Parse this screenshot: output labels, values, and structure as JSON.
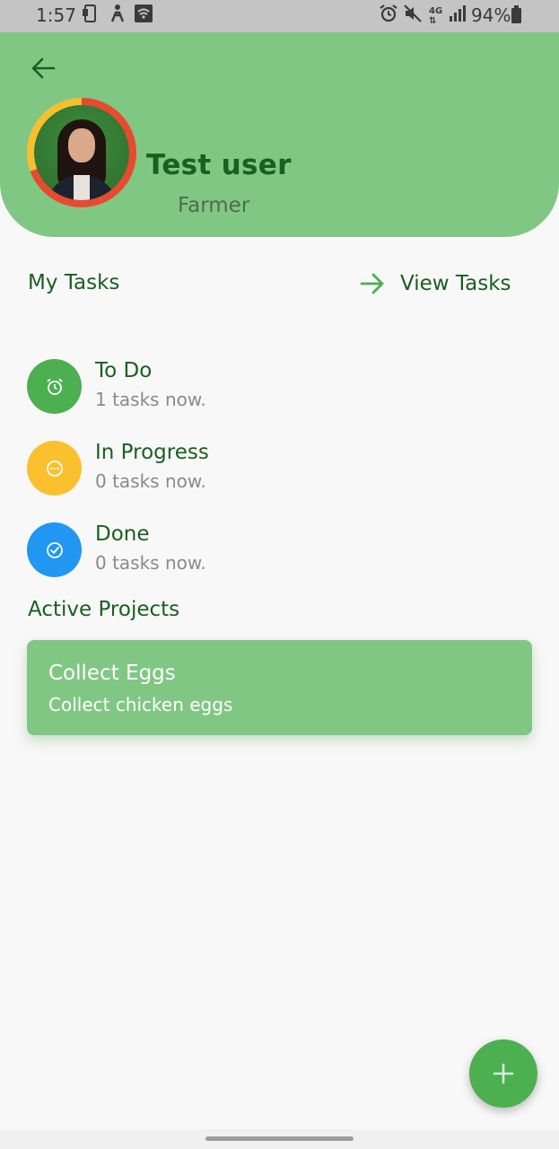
{
  "status_bar": {
    "time": "1:57",
    "battery_percent": "94%",
    "left_icons": [
      "screenshot-icon",
      "accessibility-icon",
      "wifi-icon"
    ],
    "right_icons": [
      "alarm-icon",
      "mute-icon",
      "4g-icon",
      "signal-icon",
      "battery-icon"
    ]
  },
  "header": {
    "user_name": "Test user",
    "user_role": "Farmer",
    "avatar_ring_colors": [
      "#e84a2f",
      "#f5c030"
    ],
    "background": "#81c784"
  },
  "tasks_section": {
    "title": "My Tasks",
    "view_label": "View Tasks",
    "items": [
      {
        "title": "To Do",
        "subtitle": "1 tasks now.",
        "icon": "alarm-clock-icon",
        "color": "#4caf50"
      },
      {
        "title": "In Progress",
        "subtitle": "0 tasks now.",
        "icon": "loading-icon",
        "color": "#fbc02d"
      },
      {
        "title": "Done",
        "subtitle": "0 tasks now.",
        "icon": "check-circle-icon",
        "color": "#2196f3"
      }
    ]
  },
  "projects_section": {
    "title": "Active Projects",
    "items": [
      {
        "title": "Collect Eggs",
        "description": "Collect chicken eggs"
      }
    ]
  },
  "fab": {
    "icon": "plus-icon",
    "color": "#4caf50"
  },
  "colors": {
    "primary_dark": "#1b5e20",
    "primary": "#4caf50",
    "primary_light": "#81c784",
    "muted_text": "#8a8a8a"
  }
}
